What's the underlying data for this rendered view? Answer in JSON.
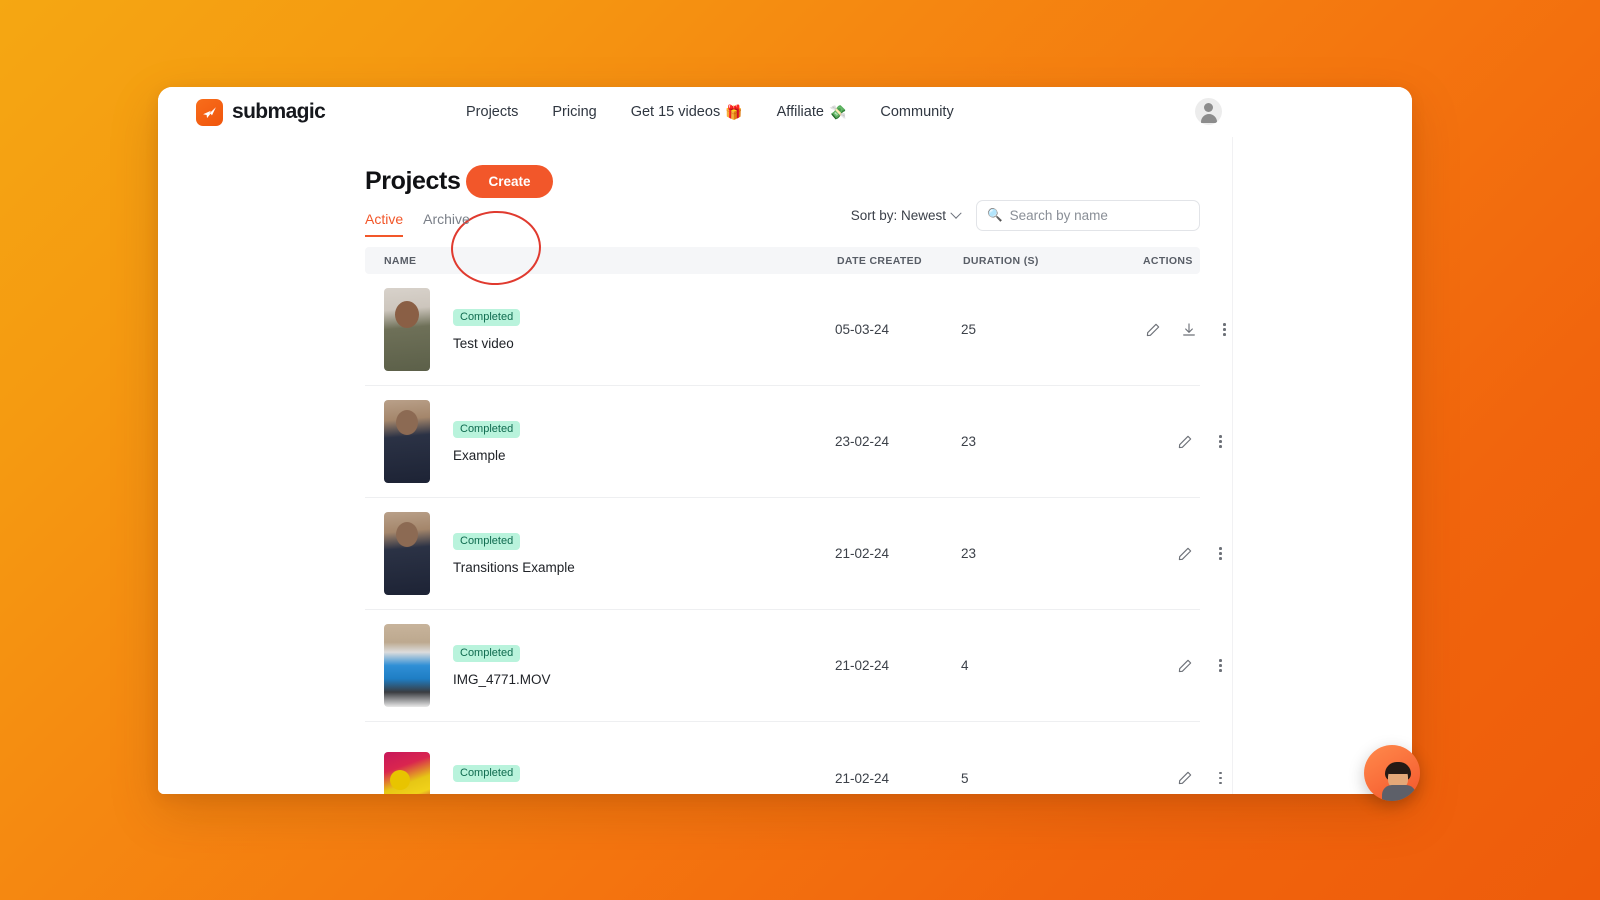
{
  "brand": {
    "name": "submagic",
    "logo_icon": "submagic-rocket-icon",
    "logo_color": "#F0550C"
  },
  "nav": {
    "links": [
      {
        "label": "Projects",
        "emoji": ""
      },
      {
        "label": "Pricing",
        "emoji": ""
      },
      {
        "label": "Get 15 videos",
        "emoji": "🎁"
      },
      {
        "label": "Affiliate",
        "emoji": "💸"
      },
      {
        "label": "Community",
        "emoji": ""
      }
    ],
    "avatar_icon": "user-avatar-icon"
  },
  "page": {
    "title": "Projects",
    "create_label": "Create",
    "create_color": "#F2572A",
    "annotation_color": "#E03A2F"
  },
  "tabs": [
    {
      "label": "Active",
      "active": true
    },
    {
      "label": "Archive",
      "active": false
    }
  ],
  "controls": {
    "sort_label": "Sort by: Newest",
    "sort_chevron_icon": "chevron-down-icon",
    "search_icon": "🔍",
    "search_value": "",
    "search_placeholder": "Search by name"
  },
  "table": {
    "headers": {
      "name": "NAME",
      "date": "DATE CREATED",
      "duration": "DURATION (S)",
      "actions": "ACTIONS"
    },
    "rows": [
      {
        "status": "Completed",
        "name": "Test video",
        "date": "05-03-24",
        "duration": "25",
        "has_download": true,
        "thumb_class": "ph1"
      },
      {
        "status": "Completed",
        "name": "Example",
        "date": "23-02-24",
        "duration": "23",
        "has_download": false,
        "thumb_class": "ph2"
      },
      {
        "status": "Completed",
        "name": "Transitions Example",
        "date": "21-02-24",
        "duration": "23",
        "has_download": false,
        "thumb_class": "ph3"
      },
      {
        "status": "Completed",
        "name": "IMG_4771.MOV",
        "date": "21-02-24",
        "duration": "4",
        "has_download": false,
        "thumb_class": "ph4"
      },
      {
        "status": "Completed",
        "name": "",
        "date": "21-02-24",
        "duration": "5",
        "has_download": false,
        "thumb_class": "ph5"
      }
    ]
  },
  "chat": {
    "icon": "support-agent-avatar-icon"
  }
}
